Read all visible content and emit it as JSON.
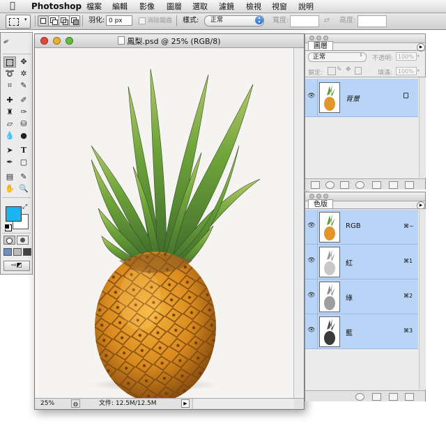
{
  "menubar": {
    "app_name": "Photoshop",
    "items": [
      "檔案",
      "編輯",
      "影像",
      "圖層",
      "選取",
      "濾鏡",
      "檢視",
      "視窗",
      "說明"
    ]
  },
  "options": {
    "feather_label": "羽化:",
    "feather_value": "0 px",
    "antialias_label": "消除鋸齒",
    "style_label": "樣式:",
    "style_value": "正常",
    "width_label": "寬度:",
    "height_label": "高度:"
  },
  "document": {
    "title": "鳳梨.psd @ 25% (RGB/8)",
    "zoom": "25%",
    "file_info": "文件: 12.5M/12.5M"
  },
  "layers_panel": {
    "tab": "圖層",
    "blend_mode": "正常",
    "opacity_label": "不透明:",
    "opacity_value": "100%",
    "lock_label": "鎖定:",
    "fill_label": "填滿:",
    "fill_value": "100%",
    "layers": [
      {
        "name": "背景"
      }
    ]
  },
  "channels_panel": {
    "tab": "色版",
    "channels": [
      {
        "name": "RGB",
        "shortcut": "⌘~"
      },
      {
        "name": "紅",
        "shortcut": "⌘1"
      },
      {
        "name": "綠",
        "shortcut": "⌘2"
      },
      {
        "name": "藍",
        "shortcut": "⌘3"
      }
    ]
  },
  "colors": {
    "foreground": "#1ab4ee",
    "background": "#ffffff",
    "selection": "#b9d4f6"
  }
}
